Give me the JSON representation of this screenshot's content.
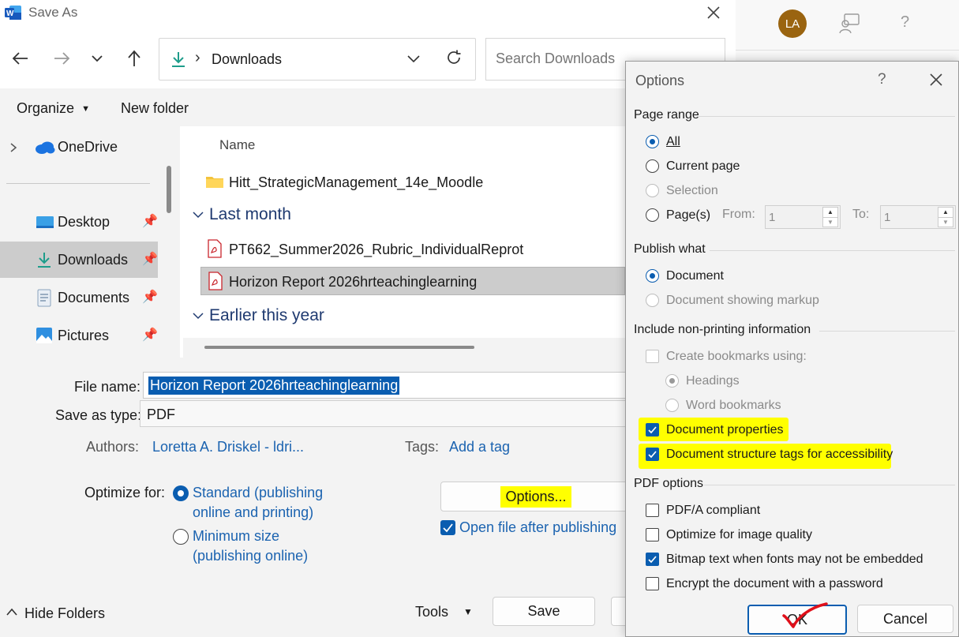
{
  "save_as": {
    "title": "Save As",
    "address": {
      "location": "Downloads",
      "separator": "›"
    },
    "search": {
      "placeholder": "Search Downloads"
    },
    "toolbar": {
      "organize": "Organize",
      "new_folder": "New folder"
    },
    "nav_items": [
      "OneDrive",
      "Desktop",
      "Downloads",
      "Documents",
      "Pictures"
    ],
    "column_name": "Name",
    "files": {
      "folder": "Hitt_StrategicManagement_14e_Moodle",
      "group_last_month": "Last month",
      "pdf1": "PT662_Summer2026_Rubric_IndividualReprot",
      "pdf2": "Horizon Report 2026hrteachinglearning",
      "group_earlier": "Earlier this year"
    },
    "form": {
      "file_name_label": "File name:",
      "file_name_value": "Horizon Report 2026hrteachinglearning",
      "save_type_label": "Save as type:",
      "save_type_value": "PDF",
      "authors_label": "Authors:",
      "authors_value": "Loretta A. Driskel - ldri...",
      "tags_label": "Tags:",
      "tags_value": "Add a tag",
      "optimize_label": "Optimize for:",
      "standard_l1": "Standard (publishing",
      "standard_l2": "online and printing)",
      "minimum_l1": "Minimum size",
      "minimum_l2": "(publishing online)",
      "options_button": "Options...",
      "open_after": "Open file after publishing"
    },
    "footer": {
      "hide_folders": "Hide Folders",
      "tools": "Tools",
      "save": "Save"
    }
  },
  "app": {
    "avatar_initials": "LA",
    "help": "?"
  },
  "options": {
    "title": "Options",
    "help": "?",
    "page_range": {
      "heading": "Page range",
      "all": "All",
      "current_page": "Current page",
      "selection": "Selection",
      "pages": "Page(s)",
      "from_label": "From:",
      "from_value": "1",
      "to_label": "To:",
      "to_value": "1"
    },
    "publish_what": {
      "heading": "Publish what",
      "document": "Document",
      "showing_markup": "Document showing markup"
    },
    "non_printing": {
      "heading": "Include non-printing information",
      "create_bookmarks": "Create bookmarks using:",
      "headings": "Headings",
      "word_bookmarks": "Word bookmarks",
      "doc_properties": "Document properties",
      "structure_tags": "Document structure tags for accessibility"
    },
    "pdf_options": {
      "heading": "PDF options",
      "pdfa": "PDF/A compliant",
      "image_quality": "Optimize for image quality",
      "bitmap_text": "Bitmap text when fonts may not be embedded",
      "encrypt": "Encrypt the document with a password"
    },
    "ok": "OK",
    "cancel": "Cancel"
  },
  "colors": {
    "accent": "#0a5db0",
    "highlight": "#ffff00",
    "annotation": "#e0101a"
  }
}
